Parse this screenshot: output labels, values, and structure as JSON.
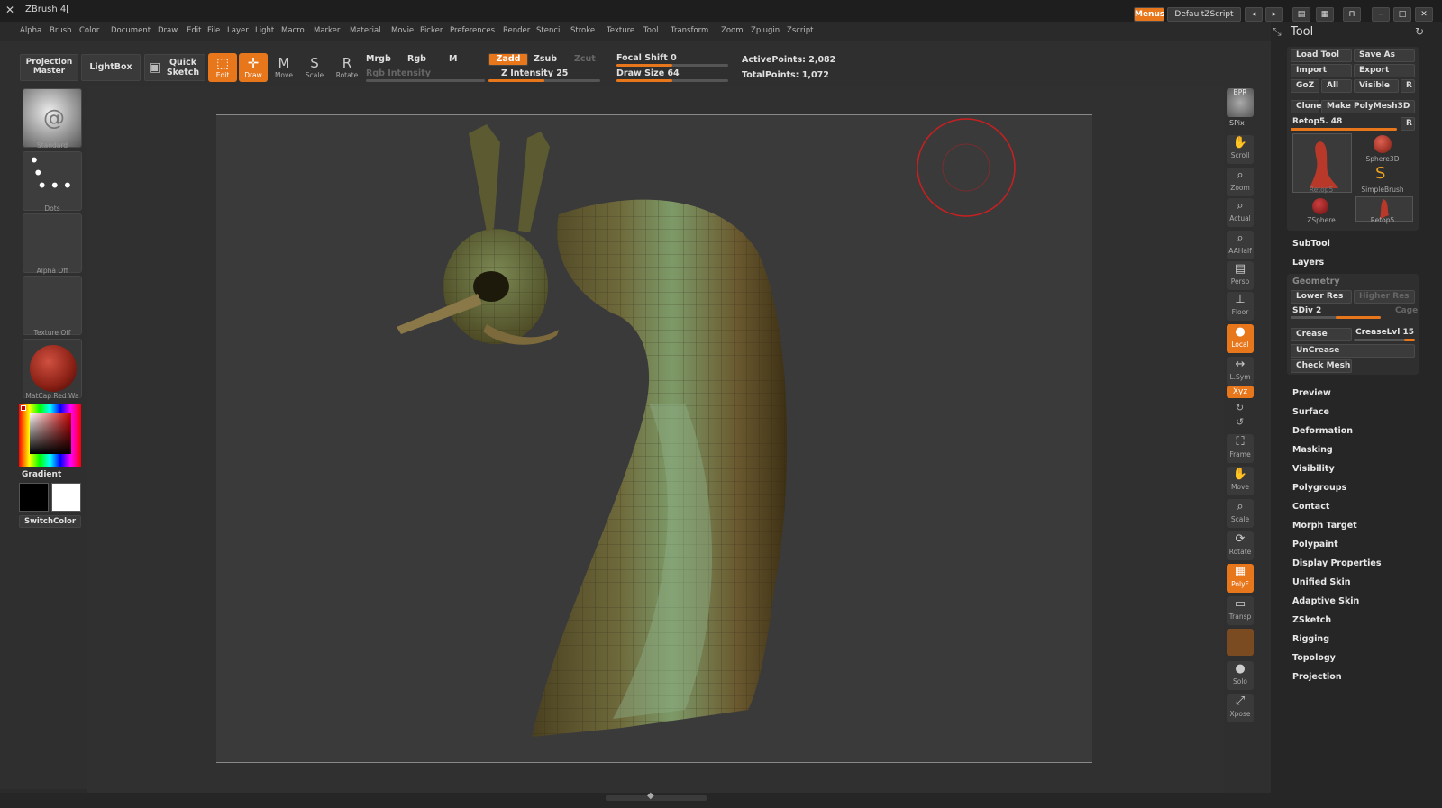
{
  "app": {
    "title": "ZBrush 4[",
    "menus_label": "Menus",
    "zscript_label": "DefaultZScript"
  },
  "menubar": [
    "Alpha",
    "Brush",
    "Color",
    "Document",
    "Draw",
    "Edit",
    "File",
    "Layer",
    "Light",
    "Macro",
    "Marker",
    "Material",
    "Movie",
    "Picker",
    "Preferences",
    "Render",
    "Stencil",
    "Stroke",
    "Texture",
    "Tool",
    "Transform",
    "Zoom",
    "Zplugin",
    "Zscript"
  ],
  "toolbar": {
    "projection_master": "Projection Master",
    "lightbox": "LightBox",
    "quick_sketch": "Quick Sketch",
    "edit": "Edit",
    "draw": "Draw",
    "move": "Move",
    "scale": "Scale",
    "rotate": "Rotate",
    "mrgb": "Mrgb",
    "rgb": "Rgb",
    "m": "M",
    "rgb_intensity": "Rgb Intensity",
    "zadd": "Zadd",
    "zsub": "Zsub",
    "zcut": "Zcut",
    "z_intensity": "Z Intensity 25",
    "focal_shift": "Focal Shift 0",
    "draw_size": "Draw Size 64",
    "active_points": "ActivePoints: 2,082",
    "total_points": "TotalPoints: 1,072"
  },
  "left_shelf": {
    "brush": "Standard",
    "stroke": "Dots",
    "alpha": "Alpha Off",
    "texture": "Texture Off",
    "material": "MatCap Red Wa",
    "gradient": "Gradient",
    "switch_color": "SwitchColor"
  },
  "right_shelf": [
    "BPR",
    "SPix",
    "Scroll",
    "Zoom",
    "Actual",
    "AAHalf",
    "Persp",
    "Floor",
    "Local",
    "L.Sym",
    "Xyz",
    "Frame",
    "Move",
    "Scale",
    "Rotate",
    "PolyF",
    "Transp",
    "Solo",
    "Xpose"
  ],
  "tool_panel": {
    "title": "Tool",
    "load_tool": "Load Tool",
    "save_as": "Save As",
    "import": "Import",
    "export": "Export",
    "goz": "GoZ",
    "all": "All",
    "visible": "Visible",
    "r": "R",
    "clone": "Clone",
    "make_polymesh": "Make PolyMesh3D",
    "current_tool": "Retop5. 48",
    "subtools": [
      "Retop5",
      "Sphere3D",
      "SimpleBrush",
      "ZSphere",
      "Retop5"
    ],
    "subtool": "SubTool",
    "layers": "Layers",
    "geometry": "Geometry",
    "lower_res": "Lower Res",
    "higher_res": "Higher Res",
    "sdiv": "SDiv 2",
    "cage": "Cage",
    "crease": "Crease",
    "crease_lvl": "CreaseLvl 15",
    "uncrease": "UnCrease",
    "check_mesh": "Check Mesh",
    "sections": [
      "Preview",
      "Surface",
      "Deformation",
      "Masking",
      "Visibility",
      "Polygroups",
      "Contact",
      "Morph Target",
      "Polypaint",
      "Display Properties",
      "Unified Skin",
      "Adaptive Skin",
      "ZSketch",
      "Rigging",
      "Topology",
      "Projection"
    ]
  },
  "colors": {
    "accent": "#e8761b",
    "mesh": "#6b7a4a"
  }
}
